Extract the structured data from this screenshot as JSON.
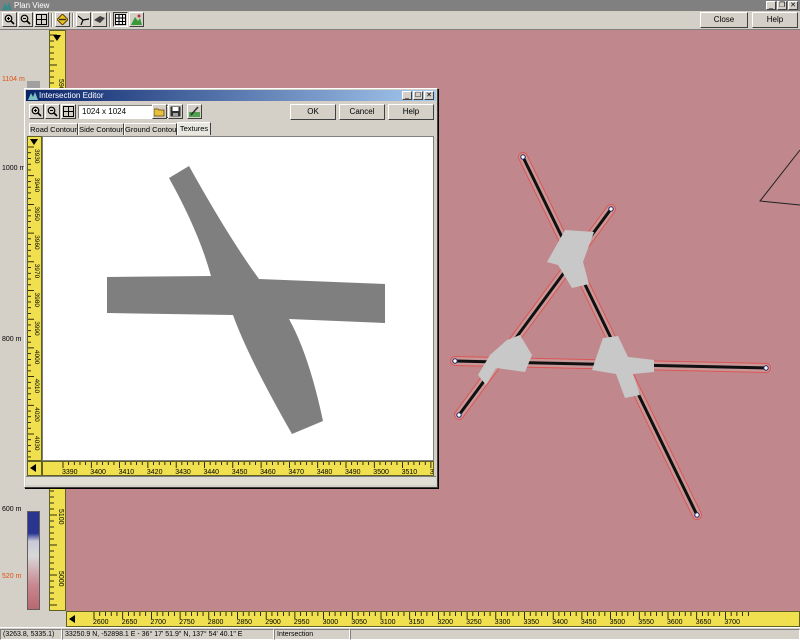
{
  "main_window": {
    "title": "Plan View",
    "close_button": "Close",
    "help_button": "Help",
    "title_controls": [
      "_",
      "❐",
      "✕"
    ]
  },
  "main_toolbar": {
    "buttons": [
      "zoom-in-icon",
      "zoom-out-icon",
      "zoom-fit-icon",
      "intersection-tool-icon",
      "road-tool-icon",
      "link-tool-icon",
      "grid-toggle-icon",
      "terrain-tool-icon"
    ]
  },
  "elevation_scale": {
    "max_label": "1104 m",
    "min_label": "520 m",
    "mid_labels": [
      "1000 m",
      "800 m",
      "600 m"
    ],
    "colors": {
      "top": "#2a3590",
      "mid": "#d8d8d8",
      "bottom": "#b86870"
    }
  },
  "vertical_ruler_main": {
    "ticks": [
      "5900",
      "5100",
      "5000"
    ]
  },
  "horizontal_ruler_main": {
    "ticks": [
      "2600",
      "2650",
      "2700",
      "2750",
      "2800",
      "2850",
      "2900",
      "2950",
      "3000",
      "3050",
      "3100",
      "3150",
      "3200",
      "3250",
      "3300",
      "3350",
      "3400",
      "3450",
      "3500",
      "3550",
      "3600",
      "3650",
      "3700"
    ]
  },
  "status_bar": {
    "coords": "(3263.8, 5335.1)",
    "geo": "33250.9 N, -52898.1 E  -  36° 17' 51.9\" N, 137° 54' 40.1\" E",
    "mode": "Intersection"
  },
  "dialog": {
    "title": "Intersection Editor",
    "resolution": "1024 x 1024",
    "ok": "OK",
    "cancel": "Cancel",
    "help": "Help",
    "title_controls": [
      "_",
      "☐",
      "✕"
    ],
    "tabs": [
      "Road Contour",
      "Side Contour",
      "Ground Contour",
      "Textures"
    ],
    "active_tab": "Textures",
    "vertical_ruler": [
      "3930",
      "3940",
      "3950",
      "3960",
      "3970",
      "3980",
      "3990",
      "4000",
      "4010",
      "4020",
      "4030"
    ],
    "horizontal_ruler": [
      "3390",
      "3400",
      "3410",
      "3420",
      "3430",
      "3440",
      "3450",
      "3460",
      "3470",
      "3480",
      "3490",
      "3500",
      "3510",
      "352"
    ]
  },
  "colors": {
    "terrain": "#c0888c",
    "road": "#7f7f7f",
    "ruler": "#f0e050",
    "titlebar_active": "#0a246a"
  }
}
